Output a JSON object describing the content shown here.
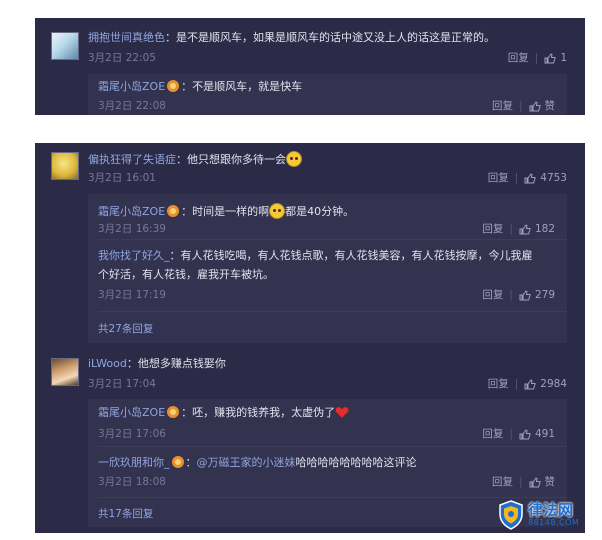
{
  "panel1": {
    "comment": {
      "user": "拥抱世间真绝色",
      "text": "是不是顺风车，如果是顺风车的话中途又没上人的话这是正常的。",
      "time": "3月2日 22:05",
      "reply_label": "回复",
      "like_count": "1"
    },
    "reply": {
      "user": "霜尾小岛ZOE",
      "text": "不是顺风车，就是快车",
      "time": "3月2日 22:08",
      "reply_label": "回复",
      "like_label": "赞"
    }
  },
  "panel2": {
    "comment1": {
      "user": "偏执狂得了失语症",
      "text": "他只想跟你多待一会",
      "time": "3月2日 16:01",
      "reply_label": "回复",
      "like_count": "4753",
      "replies": [
        {
          "user": "霜尾小岛ZOE",
          "text_a": "时间是一样的啊",
          "text_b": "都是40分钟。",
          "time": "3月2日 16:39",
          "reply_label": "回复",
          "like_count": "182"
        },
        {
          "user": "我你找了好久_",
          "text_line1": "有人花钱吃喝，有人花钱点歌，有人花钱美容，有人花钱按摩，今儿我雇",
          "text_line2": "个好活，有人花钱，雇我开车被坑。",
          "time": "3月2日 17:19",
          "reply_label": "回复",
          "like_count": "279"
        }
      ],
      "more": "共27条回复"
    },
    "comment2": {
      "user": "iLWood",
      "text": "他想多赚点钱娶你",
      "time": "3月2日 17:04",
      "reply_label": "回复",
      "like_count": "2984",
      "replies": [
        {
          "user": "霜尾小岛ZOE",
          "text": "呸，赚我的钱养我，太虚伪了",
          "time": "3月2日 17:06",
          "reply_label": "回复",
          "like_count": "491"
        },
        {
          "user": "一欣玖朋和你_",
          "mention": "@万磁王家的小迷妹",
          "text": "哈哈哈哈哈哈哈哈这评论",
          "time": "3月2日 18:08",
          "reply_label": "回复",
          "like_label": "赞"
        }
      ],
      "more": "共17条回复"
    }
  },
  "watermark": {
    "title": "律法网",
    "url": "88148.COM"
  },
  "colors": {
    "panel_bg": "#2c2b47",
    "reply_bg": "#33324f",
    "username": "#8fa6e0",
    "timestamp": "#77779a"
  }
}
